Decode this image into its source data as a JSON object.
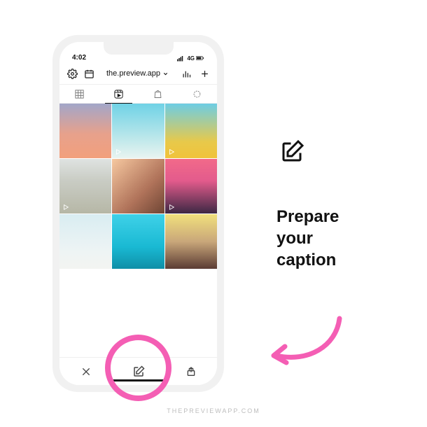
{
  "status": {
    "time": "4:02",
    "network": "4G"
  },
  "header": {
    "account_name": "the.preview.app"
  },
  "tabs": {
    "grid": "grid",
    "reels": "reels",
    "shop": "shop",
    "loading": "loading"
  },
  "grid_cells": [
    {
      "is_video": false
    },
    {
      "is_video": true
    },
    {
      "is_video": true
    },
    {
      "is_video": true
    },
    {
      "is_video": false
    },
    {
      "is_video": true
    },
    {
      "is_video": false
    },
    {
      "is_video": false
    },
    {
      "is_video": false
    }
  ],
  "bottom_bar": {
    "close": "close",
    "compose": "compose",
    "share": "share"
  },
  "side": {
    "headline": "Prepare\nyour\ncaption"
  },
  "watermark": "THEPREVIEWAPP.COM",
  "colors": {
    "highlight": "#f45eb4"
  }
}
